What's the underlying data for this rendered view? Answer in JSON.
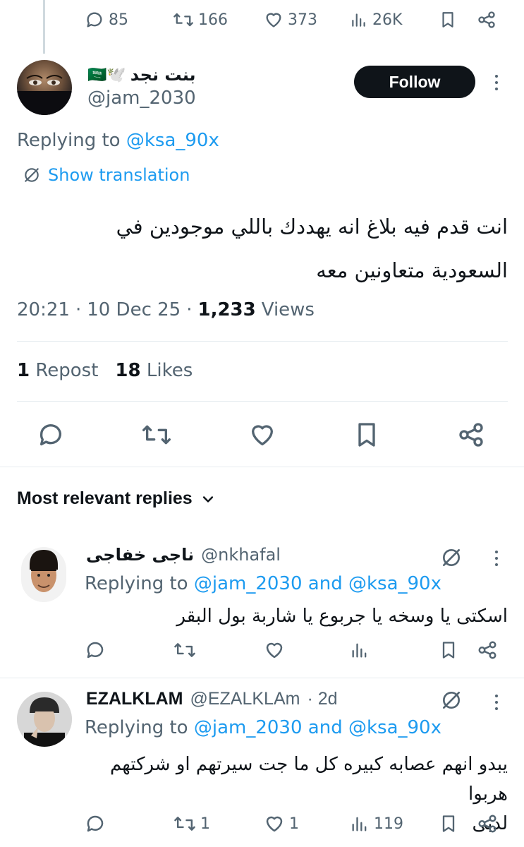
{
  "top_actions": {
    "replies": "85",
    "reposts": "166",
    "likes": "373",
    "views": "26K"
  },
  "tweet": {
    "display_name": "بنت نجد",
    "name_emojis": "🇸🇦🕊️",
    "handle": "@jam_2030",
    "follow_label": "Follow",
    "replying_prefix": "Replying to",
    "replying_to": "@ksa_90x",
    "translate_label": "Show translation",
    "text_line1": "انت قدم فيه بلاغ انه يهددك باللي موجودين في",
    "text_line2": "السعودية متعاونين معه",
    "time": "20:21",
    "sep": "·",
    "date": "10 Dec 25",
    "views_count": "1,233",
    "views_label": "Views",
    "reposts_count": "1",
    "reposts_label": "Repost",
    "likes_count": "18",
    "likes_label": "Likes"
  },
  "replies_header": {
    "label": "Most relevant replies"
  },
  "replies": [
    {
      "display_name": "ناجى خفاجى",
      "handle": "@nkhafal",
      "replying_prefix": "Replying to",
      "replying_to_1": "@jam_2030",
      "and": "and",
      "replying_to_2": "@ksa_90x",
      "text": "اسكتى يا وسخه يا جربوع يا شاربة بول البقر"
    },
    {
      "display_name": "EZALKLAM",
      "handle": "@EZALKLAm",
      "time_ago": "· 2d",
      "replying_prefix": "Replying to",
      "replying_to_1": "@jam_2030",
      "and": "and",
      "replying_to_2": "@ksa_90x",
      "text_line1": "يبدو انهم عصابه كبيره كل ما جت سيرتهم او شركتهم هربوا",
      "text_line2": "لدبى",
      "reposts": "1",
      "likes": "1",
      "views": "119"
    }
  ],
  "colors": {
    "accent": "#1d9bf0",
    "text": "#0f1419",
    "muted": "#536471",
    "button": "#0f1419"
  }
}
